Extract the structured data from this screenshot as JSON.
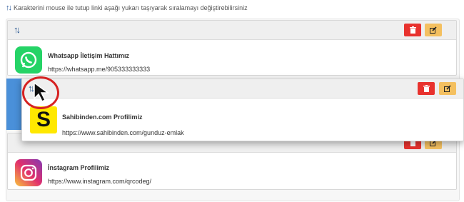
{
  "hint": {
    "text": "Karakterini mouse ile tutup linki aşağı yukarı taşıyarak sıralamayı değiştirebilirsiniz"
  },
  "links": [
    {
      "title": "Whatsapp İletişim Hattımız",
      "url": "https://whatsapp.me/905333333333",
      "logo_icon": "whatsapp-logo",
      "logo_color": "#25d366"
    },
    {
      "title": "Sahibinden.com Profilimiz",
      "url": "https://www.sahibinden.com/gunduz-emlak",
      "logo_icon": "sahibinden-logo",
      "logo_color": "#ffe800",
      "logo_letter": "S"
    },
    {
      "title": "İnstagram Profilimiz",
      "url": "https://www.instagram.com/qrcodeg/",
      "logo_icon": "instagram-logo",
      "logo_color": "#e1306c"
    }
  ],
  "colors": {
    "delete": "#e8322e",
    "edit": "#f4c060",
    "drag_placeholder": "#4a90d9",
    "highlight_ring": "#d62222"
  },
  "icons": {
    "drag": "up-down-arrows-icon",
    "delete": "trash-icon",
    "edit": "edit-icon",
    "cursor": "mouse-pointer-icon"
  }
}
